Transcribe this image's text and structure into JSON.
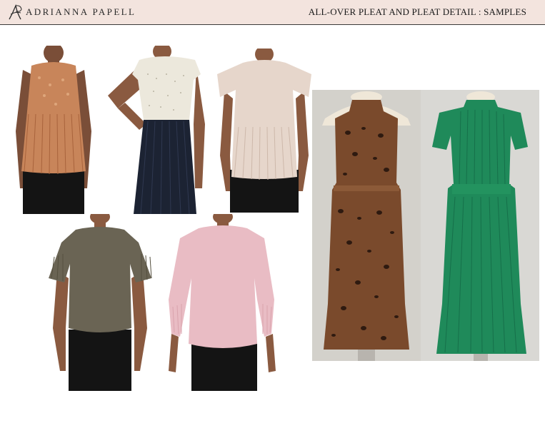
{
  "header": {
    "brand": "ADRIANNA PAPELL",
    "title": "ALL-OVER PLEAT AND PLEAT DETAIL : SAMPLES",
    "background_color": "#f3e4de"
  },
  "products": [
    {
      "name": "rust-floral-pleated-sleeveless-top",
      "color": "#c8855a"
    },
    {
      "name": "ivory-dot-flutter-top-navy-pleated-skirt",
      "color": "#ece8dc"
    },
    {
      "name": "blush-pleated-flutter-sleeve-top",
      "color": "#e6d6cb"
    },
    {
      "name": "olive-pleated-sleeve-top",
      "color": "#6a6454"
    },
    {
      "name": "pink-pleated-balloon-sleeve-top",
      "color": "#e9bcc4"
    },
    {
      "name": "leopard-pleated-halter-dress",
      "color": "#7a4a2c"
    },
    {
      "name": "emerald-pleated-flutter-dress",
      "color": "#1f8a5a"
    }
  ]
}
